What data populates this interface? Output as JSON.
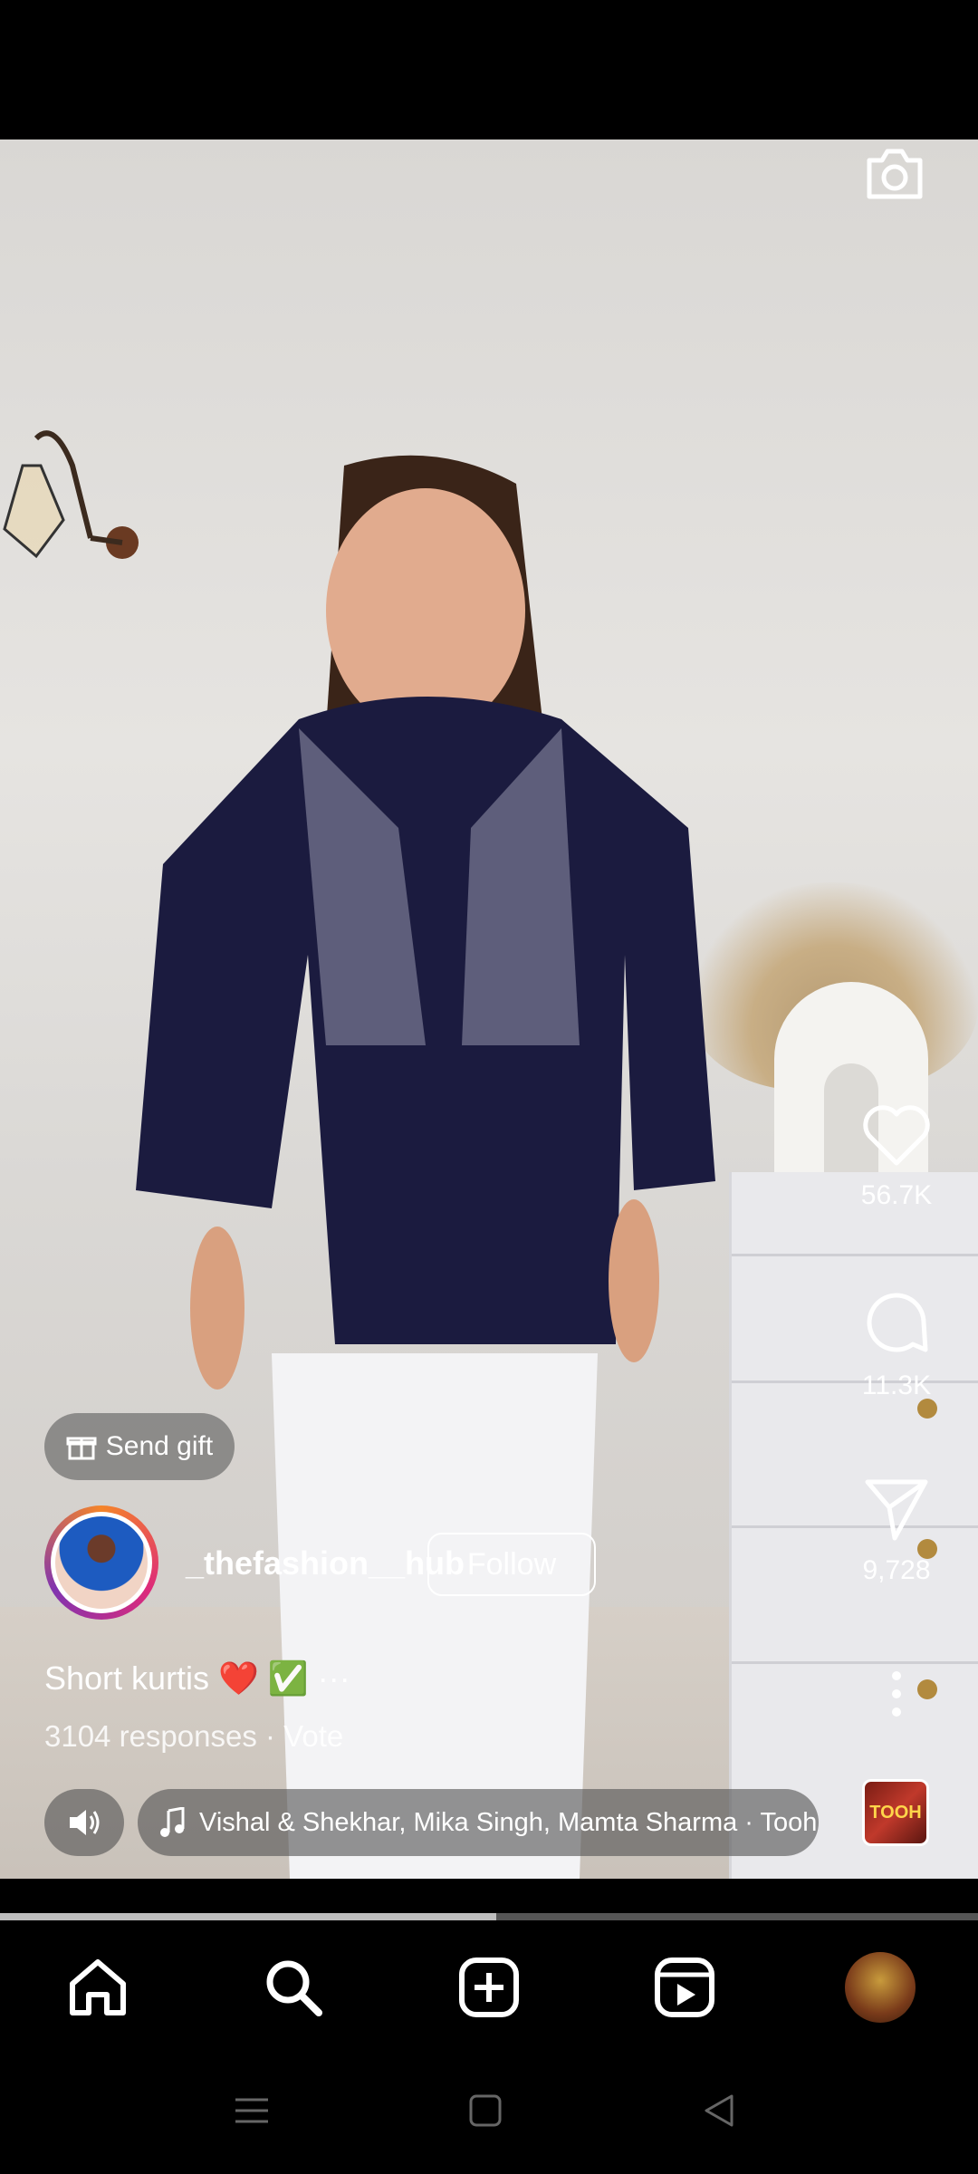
{
  "reel": {
    "likes": "56.7K",
    "comments": "11.3K",
    "shares": "9,728",
    "send_gift_label": "Send gift",
    "username": "_thefashion__hub",
    "follow_label": "Follow",
    "caption": "Short kurtis ❤️ ✅",
    "caption_more": "···",
    "responses": "3104 responses · Vote",
    "music": "Vishal & Shekhar, Mika Singh, Mamta Sharma · Tooh",
    "album_text": "TOOH",
    "progress": 0.507
  },
  "colors": {
    "background": "#000000",
    "text": "#ffffff",
    "pill_bg": "rgba(80,80,80,0.6)",
    "progress_track": "#555555",
    "progress_fill": "#bdbdbd"
  },
  "icons": {
    "top_right": "camera-icon",
    "actions": [
      "heart-icon",
      "comment-icon",
      "share-icon",
      "more-vertical-icon"
    ],
    "bottom_nav": [
      "home-icon",
      "search-icon",
      "create-icon",
      "reels-icon",
      "profile-avatar"
    ],
    "system_nav": [
      "menu-icon",
      "home-square-icon",
      "back-icon"
    ]
  }
}
